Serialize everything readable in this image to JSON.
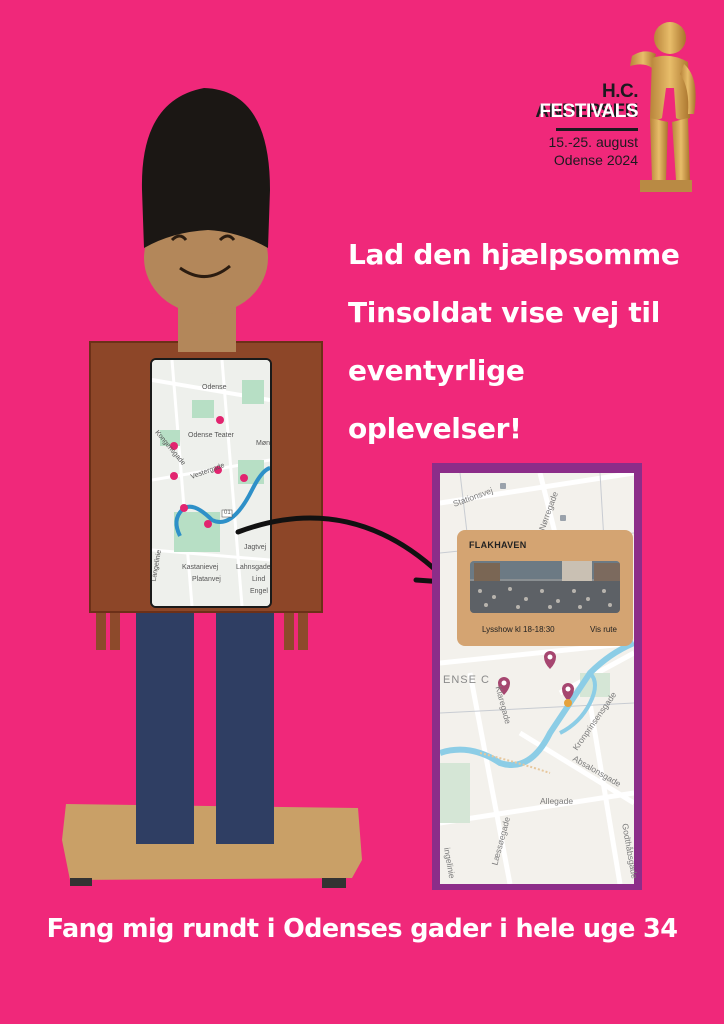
{
  "festival": {
    "name_line1": "H.C. ANDERSEN",
    "name_line2": "FESTIVALS",
    "dates": "15.-25. august",
    "place": "Odense 2024"
  },
  "headline": {
    "line1": "Lad den hjælpsomme",
    "line2": "Tinsoldat vise vej til",
    "line3": "eventyrlige",
    "line4": "oplevelser!"
  },
  "chest_map": {
    "labels": {
      "odense": "Odense",
      "teater": "Odense Teater",
      "kongensgade": "Kongensgade",
      "vestergade": "Vestergade",
      "mo": "Møn",
      "jagtvej": "Jagtvej",
      "kastanievej": "Kastanievej",
      "platanvej": "Platanvej",
      "lahnsgade": "Lahnsgade",
      "lind": "Lind",
      "engel": "Engel",
      "langelinie": "Langelinie",
      "road_no": "01"
    }
  },
  "app_map": {
    "streets": {
      "stationsvej": "Stationsvej",
      "norregade": "Nørregade",
      "bydel": "ENSE C",
      "klaregade": "Klaregade",
      "kronprinsensgade": "Kronprinsensgade",
      "absalonsgade": "Absalonsgade",
      "allegade": "Allegade",
      "laessoegade": "Læssøegade",
      "godthaabsgade": "Godthåbsgade",
      "langelinie": "ingelinie"
    },
    "popup": {
      "title": "FLAKHAVEN",
      "info": "Lysshow kl 18-18:30",
      "route_label": "Vis rute"
    }
  },
  "tagline": "Fang mig  rundt i Odenses  gader i hele uge 34",
  "colors": {
    "background": "#f0287a",
    "frame": "#8c2d89",
    "popup": "#d4a472",
    "pin": "#e2246f"
  },
  "icons": [
    "soldier-figure",
    "arrow-icon",
    "map-pin-icon",
    "statue-icon",
    "photo-crowd"
  ]
}
